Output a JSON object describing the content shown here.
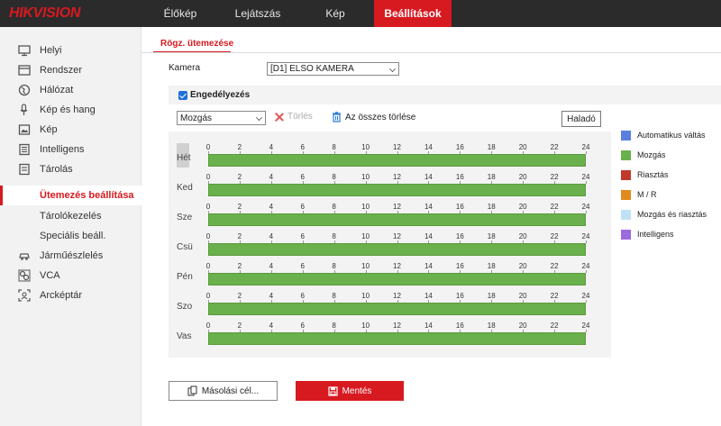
{
  "brand": "HIKVISION",
  "nav": [
    {
      "label": "Élőkép"
    },
    {
      "label": "Lejátszás"
    },
    {
      "label": "Kép"
    },
    {
      "label": "Beállítások",
      "active": true
    }
  ],
  "sidebar": {
    "items": [
      {
        "label": "Helyi",
        "icon": "monitor-icon"
      },
      {
        "label": "Rendszer",
        "icon": "system-icon"
      },
      {
        "label": "Hálózat",
        "icon": "globe-icon"
      },
      {
        "label": "Kép és hang",
        "icon": "audio-video-icon"
      },
      {
        "label": "Kép",
        "icon": "image-icon"
      },
      {
        "label": "Intelligens",
        "icon": "smart-icon"
      },
      {
        "label": "Tárolás",
        "icon": "storage-icon"
      },
      {
        "label": "Ütemezés beállítása",
        "sub": true,
        "active": true
      },
      {
        "label": "Tárolókezelés",
        "sub": true
      },
      {
        "label": "Speciális beáll.",
        "sub": true
      },
      {
        "label": "Járműészlelés",
        "icon": "vehicle-icon"
      },
      {
        "label": "VCA",
        "icon": "vca-icon"
      },
      {
        "label": "Arcképtár",
        "icon": "face-icon"
      }
    ]
  },
  "tab": {
    "label": "Rögz. ütemezése"
  },
  "camera": {
    "label": "Kamera",
    "value": "[D1] ELSO KAMERA"
  },
  "enable": {
    "label": "Engedélyezés",
    "checked": true
  },
  "toolbar": {
    "mode_value": "Mozgás",
    "delete_label": "Törlés",
    "delete_all_label": "Az összes törlése",
    "advanced_label": "Haladó"
  },
  "schedule": {
    "hour_ticks": [
      "0",
      "2",
      "4",
      "6",
      "8",
      "10",
      "12",
      "14",
      "16",
      "18",
      "20",
      "22",
      "24"
    ],
    "days": [
      "Hét",
      "Ked",
      "Sze",
      "Csü",
      "Pén",
      "Szo",
      "Vas"
    ],
    "fill_type": "Mozgás",
    "fill_color": "#6ab04c"
  },
  "legend": [
    {
      "label": "Automatikus váltás",
      "color": "#5b7fe0"
    },
    {
      "label": "Mozgás",
      "color": "#6ab04c"
    },
    {
      "label": "Riasztás",
      "color": "#c0392b"
    },
    {
      "label": "M / R",
      "color": "#e08a1e"
    },
    {
      "label": "Mozgás és riasztás",
      "color": "#bfe1f5"
    },
    {
      "label": "Intelligens",
      "color": "#9b6be0"
    }
  ],
  "buttons": {
    "copy_label": "Másolási cél...",
    "save_label": "Mentés"
  }
}
